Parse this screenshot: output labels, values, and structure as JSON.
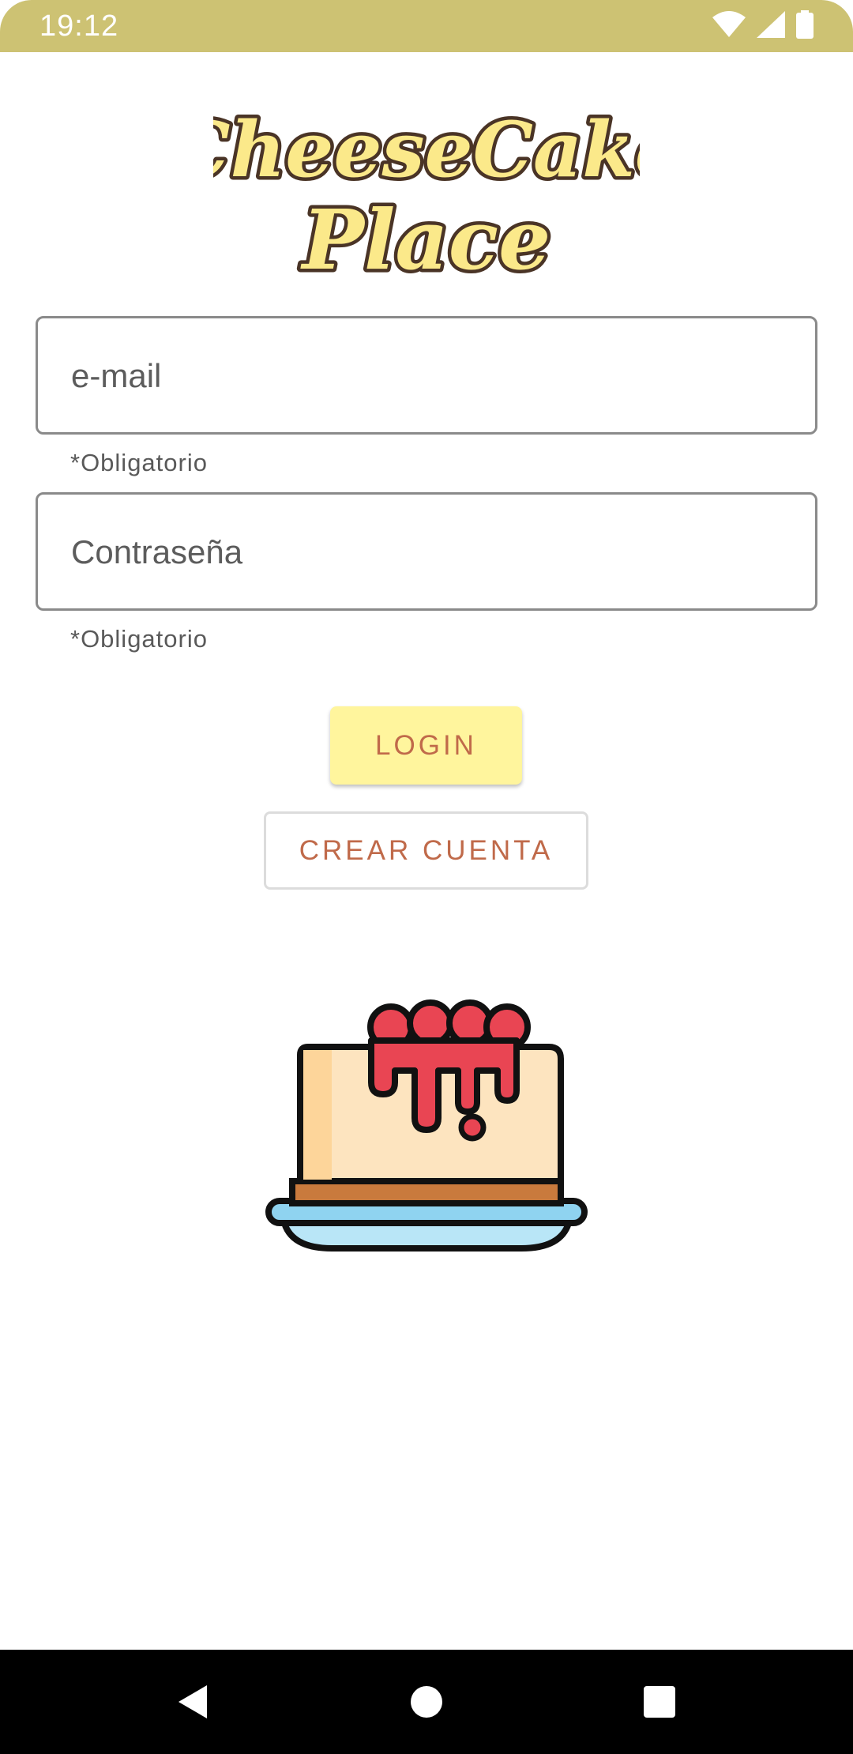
{
  "status_bar": {
    "time": "19:12",
    "icons": [
      "wifi-icon",
      "signal-icon",
      "battery-icon"
    ],
    "background": "#cdc273"
  },
  "logo": {
    "line1": "CheeseCake",
    "line2": "Place"
  },
  "form": {
    "email_placeholder": "e-mail",
    "email_helper": "*Obligatorio",
    "password_placeholder": "Contraseña",
    "password_helper": "*Obligatorio"
  },
  "buttons": {
    "login_label": "LOGIN",
    "create_account_label": "CREAR CUENTA"
  },
  "illustration": "cheesecake-icon",
  "nav_bar": {
    "icons": [
      "back-icon",
      "home-icon",
      "recents-icon"
    ]
  },
  "colors": {
    "accent_text": "#c06a4a",
    "login_button_bg": "#fff59d",
    "logo_fill": "#fbe98a",
    "logo_outline": "#4a3426"
  }
}
